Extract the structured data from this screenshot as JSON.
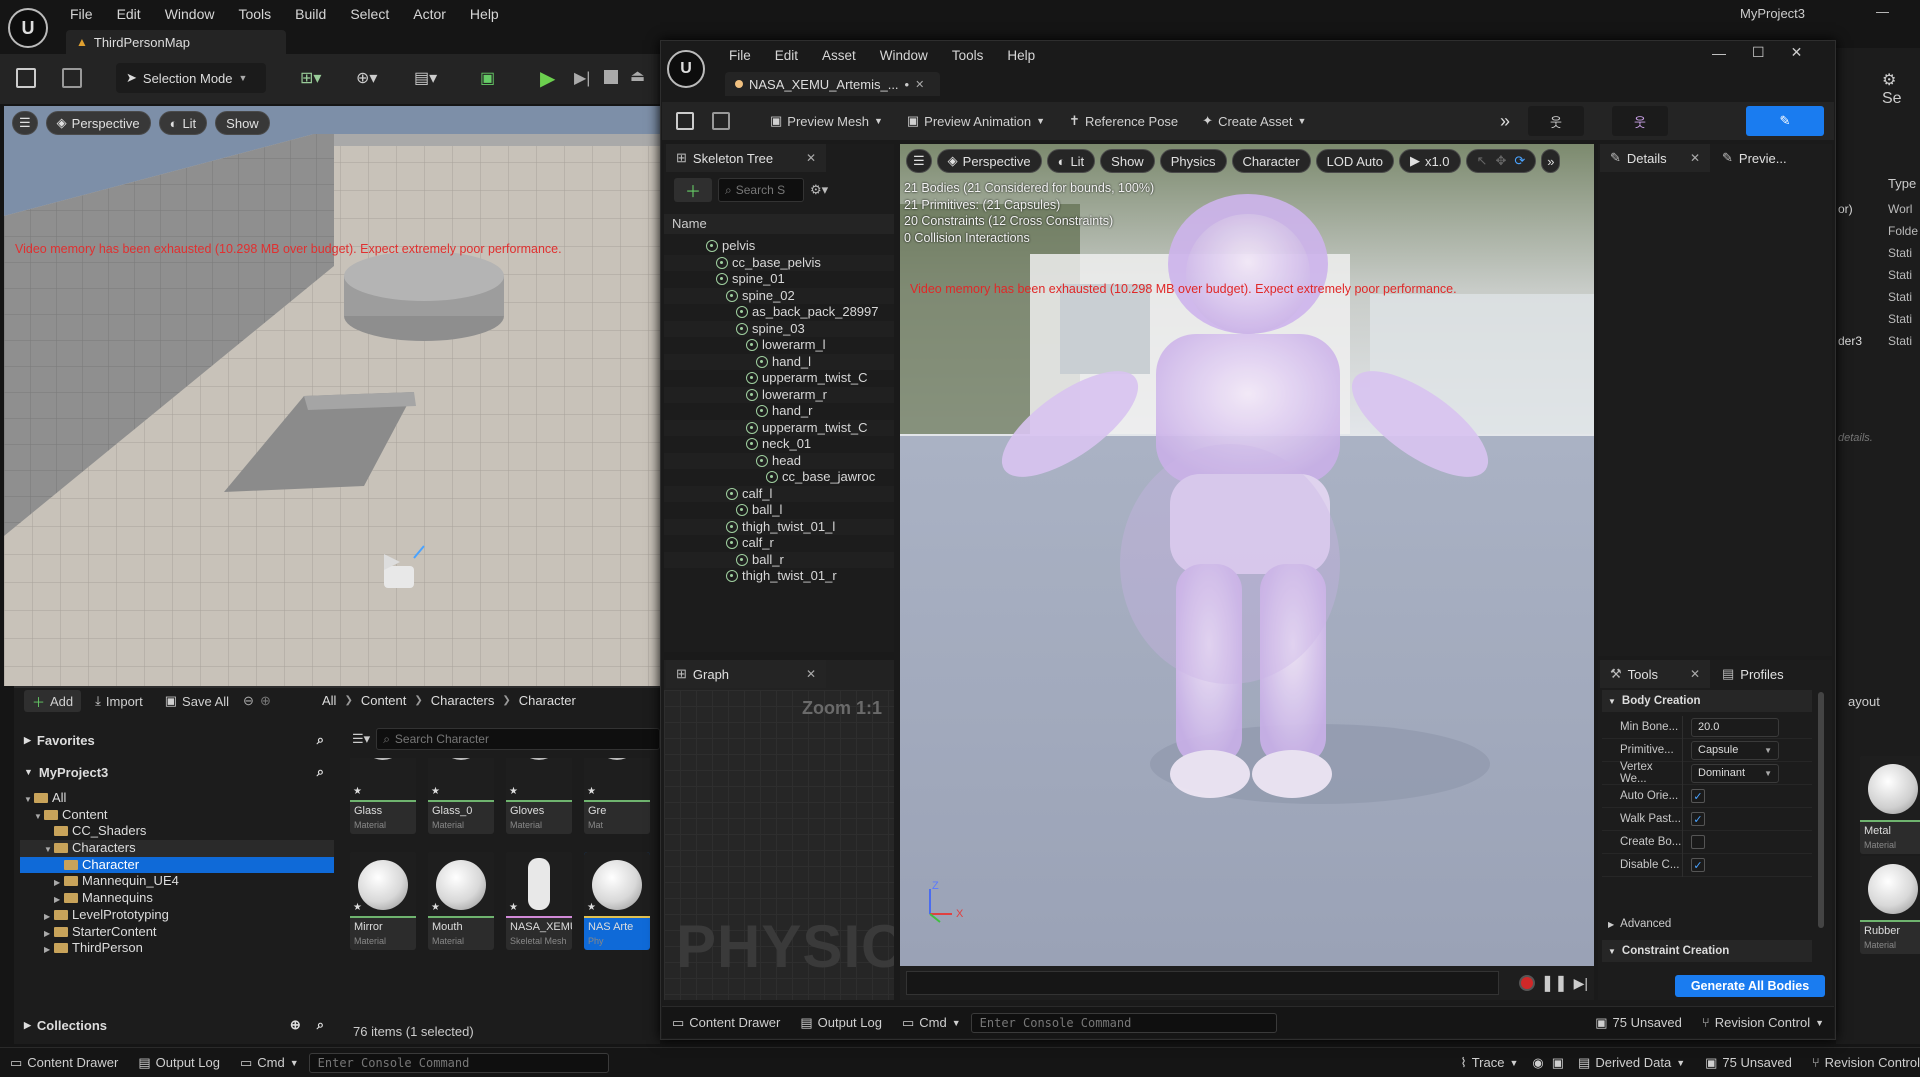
{
  "main_menu": [
    "File",
    "Edit",
    "Window",
    "Tools",
    "Build",
    "Select",
    "Actor",
    "Help"
  ],
  "project_name": "MyProject3",
  "level_tab": "ThirdPersonMap",
  "selection_mode": "Selection Mode",
  "viewport": {
    "perspective": "Perspective",
    "lit": "Lit",
    "show": "Show",
    "warning": "Video memory has been exhausted (10.298 MB over budget). Expect extremely poor performance."
  },
  "content_browser": {
    "add": "Add",
    "import": "Import",
    "save_all": "Save All",
    "breadcrumb": [
      "All",
      "Content",
      "Characters",
      "Character"
    ],
    "favorites": "Favorites",
    "project": "MyProject3",
    "search_placeholder": "Search Character",
    "collections": "Collections",
    "item_count": "76 items (1 selected)",
    "folders": [
      {
        "label": "All",
        "depth": 0
      },
      {
        "label": "Content",
        "depth": 1
      },
      {
        "label": "CC_Shaders",
        "depth": 2
      },
      {
        "label": "Characters",
        "depth": 2
      },
      {
        "label": "Character",
        "depth": 3
      },
      {
        "label": "Mannequin_UE4",
        "depth": 3
      },
      {
        "label": "Mannequins",
        "depth": 3
      },
      {
        "label": "LevelPrototyping",
        "depth": 2
      },
      {
        "label": "StarterContent",
        "depth": 2
      },
      {
        "label": "ThirdPerson",
        "depth": 2
      }
    ],
    "assets": [
      {
        "name": "Glass",
        "type": "Material"
      },
      {
        "name": "Glass_0",
        "type": "Material"
      },
      {
        "name": "Gloves",
        "type": "Material"
      },
      {
        "name": "Gre",
        "type": "Mat"
      },
      {
        "name": "Mirror",
        "type": "Material"
      },
      {
        "name": "Mouth",
        "type": "Material"
      },
      {
        "name": "NASA_XEMU_Artemis_",
        "type": "Skeletal Mesh"
      },
      {
        "name": "NAS Arte",
        "type": "Phy"
      }
    ]
  },
  "bottom_bar": {
    "content_drawer": "Content Drawer",
    "output_log": "Output Log",
    "cmd": "Cmd",
    "console_placeholder": "Enter Console Command",
    "trace": "Trace",
    "derived_data": "Derived Data",
    "unsaved": "75 Unsaved",
    "revision_control": "Revision Control"
  },
  "editor": {
    "menu": [
      "File",
      "Edit",
      "Asset",
      "Window",
      "Tools",
      "Help"
    ],
    "asset_tab": "NASA_XEMU_Artemis_...",
    "toolbar": {
      "preview_mesh": "Preview Mesh",
      "preview_animation": "Preview Animation",
      "reference_pose": "Reference Pose",
      "create_asset": "Create Asset"
    },
    "skeleton_tree": {
      "title": "Skeleton Tree",
      "search_placeholder": "Search S",
      "name_header": "Name",
      "bones": [
        {
          "label": "pelvis",
          "depth": 0
        },
        {
          "label": "cc_base_pelvis",
          "depth": 1
        },
        {
          "label": "spine_01",
          "depth": 1
        },
        {
          "label": "spine_02",
          "depth": 2
        },
        {
          "label": "as_back_pack_28997",
          "depth": 3
        },
        {
          "label": "spine_03",
          "depth": 3
        },
        {
          "label": "lowerarm_l",
          "depth": 4
        },
        {
          "label": "hand_l",
          "depth": 5
        },
        {
          "label": "upperarm_twist_C",
          "depth": 4
        },
        {
          "label": "lowerarm_r",
          "depth": 4
        },
        {
          "label": "hand_r",
          "depth": 5
        },
        {
          "label": "upperarm_twist_C",
          "depth": 4
        },
        {
          "label": "neck_01",
          "depth": 4
        },
        {
          "label": "head",
          "depth": 5
        },
        {
          "label": "cc_base_jawroc",
          "depth": 6
        },
        {
          "label": "calf_l",
          "depth": 2
        },
        {
          "label": "ball_l",
          "depth": 3
        },
        {
          "label": "thigh_twist_01_l",
          "depth": 2
        },
        {
          "label": "calf_r",
          "depth": 2
        },
        {
          "label": "ball_r",
          "depth": 3
        },
        {
          "label": "thigh_twist_01_r",
          "depth": 2
        }
      ]
    },
    "graph": {
      "title": "Graph",
      "zoom": "Zoom 1:1",
      "watermark": "PHYSIC"
    },
    "viewport": {
      "perspective": "Perspective",
      "lit": "Lit",
      "show": "Show",
      "physics": "Physics",
      "character": "Character",
      "lod": "LOD Auto",
      "speed": "x1.0",
      "stats": [
        "21 Bodies (21 Considered for bounds, 100%)",
        "21 Primitives: (21 Capsules)",
        "20 Constraints (12 Cross Constraints)",
        "0 Collision Interactions"
      ],
      "warning": "Video memory has been exhausted (10.298 MB over budget). Expect extremely poor performance."
    },
    "details": {
      "title": "Details",
      "preview": "Previe..."
    },
    "tools": {
      "title": "Tools",
      "profiles": "Profiles",
      "body_creation": "Body Creation",
      "props": [
        {
          "label": "Min Bone...",
          "value": "20.0",
          "kind": "number"
        },
        {
          "label": "Primitive...",
          "value": "Capsule",
          "kind": "dropdown"
        },
        {
          "label": "Vertex We...",
          "value": "Dominant",
          "kind": "dropdown"
        },
        {
          "label": "Auto Orie...",
          "value": true,
          "kind": "check"
        },
        {
          "label": "Walk Past...",
          "value": true,
          "kind": "check"
        },
        {
          "label": "Create Bo...",
          "value": false,
          "kind": "check"
        },
        {
          "label": "Disable C...",
          "value": true,
          "kind": "check"
        }
      ],
      "advanced": "Advanced",
      "constraint_creation": "Constraint Creation",
      "generate": "Generate All Bodies"
    },
    "bottom": {
      "content_drawer": "Content Drawer",
      "output_log": "Output Log",
      "cmd": "Cmd",
      "console_placeholder": "Enter Console Command",
      "unsaved": "75 Unsaved",
      "revision_control": "Revision Control"
    }
  },
  "outliner_right": {
    "type_header": "Type",
    "rows": [
      "or)",
      "",
      "",
      "",
      "",
      "",
      "der3"
    ],
    "types": [
      "Worl",
      "Folde",
      "Stati",
      "Stati",
      "Stati",
      "Stati",
      "Stati"
    ],
    "details_hint": "details.",
    "layout_label": "ayout",
    "assets": [
      {
        "name": "Metal",
        "type": "Material"
      },
      {
        "name": "Rubber",
        "type": "Material"
      }
    ]
  }
}
